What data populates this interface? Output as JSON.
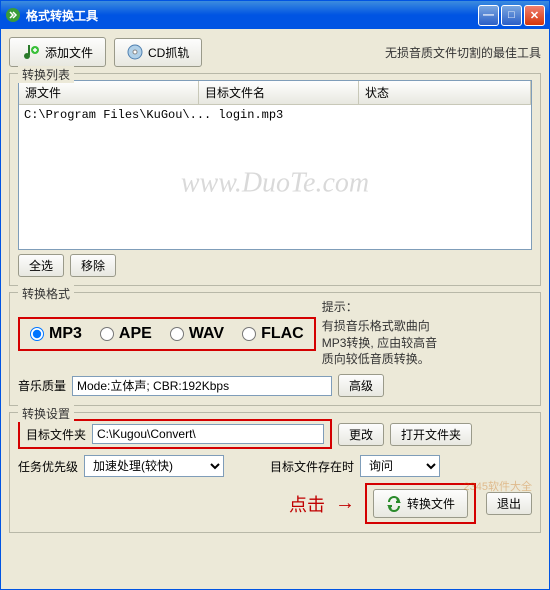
{
  "title": "格式转换工具",
  "slogan": "无损音质文件切割的最佳工具",
  "toolbar": {
    "add_files": "添加文件",
    "cd_grab": "CD抓轨"
  },
  "convert_list": {
    "legend": "转换列表",
    "cols": {
      "source": "源文件",
      "target": "目标文件名",
      "status": "状态"
    },
    "rows": [
      {
        "source": "C:\\Program Files\\KuGou\\... login.mp3",
        "target": "",
        "status": ""
      }
    ],
    "select_all": "全选",
    "remove": "移除"
  },
  "format": {
    "legend": "转换格式",
    "options": [
      "MP3",
      "APE",
      "WAV",
      "FLAC"
    ],
    "selected": "MP3",
    "hint_title": "提示：",
    "hint_body": "有损音乐格式歌曲向MP3转换, 应由较高音质向较低音质转换。",
    "quality_label": "音乐质量",
    "quality_value": "Mode:立体声; CBR:192Kbps",
    "advanced": "高级"
  },
  "settings": {
    "legend": "转换设置",
    "dest_label": "目标文件夹",
    "dest_value": "C:\\Kugou\\Convert\\",
    "change": "更改",
    "open_folder": "打开文件夹",
    "priority_label": "任务优先级",
    "priority_value": "加速处理(较快)",
    "conflict_label": "目标文件存在时",
    "conflict_value": "询问"
  },
  "bottom": {
    "annotation": "点击",
    "convert": "转换文件",
    "exit": "退出"
  },
  "watermark": "www.DuoTe.com",
  "wm2": "2345软件大全"
}
